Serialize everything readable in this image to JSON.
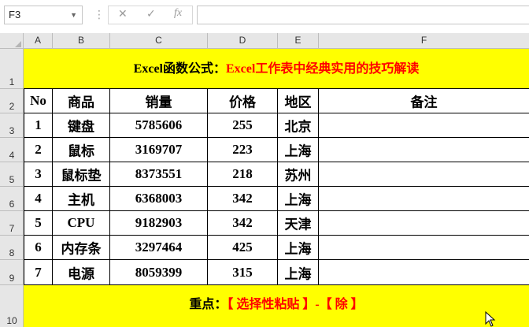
{
  "formula_bar": {
    "name_box": "F3",
    "cancel_icon": "✕",
    "confirm_icon": "✓",
    "fx_label": "fx",
    "formula": ""
  },
  "columns": [
    "A",
    "B",
    "C",
    "D",
    "E",
    "F"
  ],
  "rows": [
    "1",
    "2",
    "3",
    "4",
    "5",
    "6",
    "7",
    "8",
    "9",
    "10"
  ],
  "title": {
    "prefix": "Excel函数公式：",
    "main": "Excel工作表中经典实用的技巧解读",
    "prefix_color": "#000000",
    "main_color": "#ff0000",
    "background": "#ffff00"
  },
  "table": {
    "headers": [
      "No",
      "商品",
      "销量",
      "价格",
      "地区",
      "备注"
    ],
    "rows": [
      [
        "1",
        "键盘",
        "5785606",
        "255",
        "北京",
        ""
      ],
      [
        "2",
        "鼠标",
        "3169707",
        "223",
        "上海",
        ""
      ],
      [
        "3",
        "鼠标垫",
        "8373551",
        "218",
        "苏州",
        ""
      ],
      [
        "4",
        "主机",
        "6368003",
        "342",
        "上海",
        ""
      ],
      [
        "5",
        "CPU",
        "9182903",
        "342",
        "天津",
        ""
      ],
      [
        "6",
        "内存条",
        "3297464",
        "425",
        "上海",
        ""
      ],
      [
        "7",
        "电源",
        "8059399",
        "315",
        "上海",
        ""
      ]
    ]
  },
  "footer": {
    "label": "重点：",
    "highlight": "【 选择性粘贴 】-【 除 】",
    "label_color": "#000000",
    "highlight_color": "#ff0000"
  },
  "selected_cell": "F3"
}
